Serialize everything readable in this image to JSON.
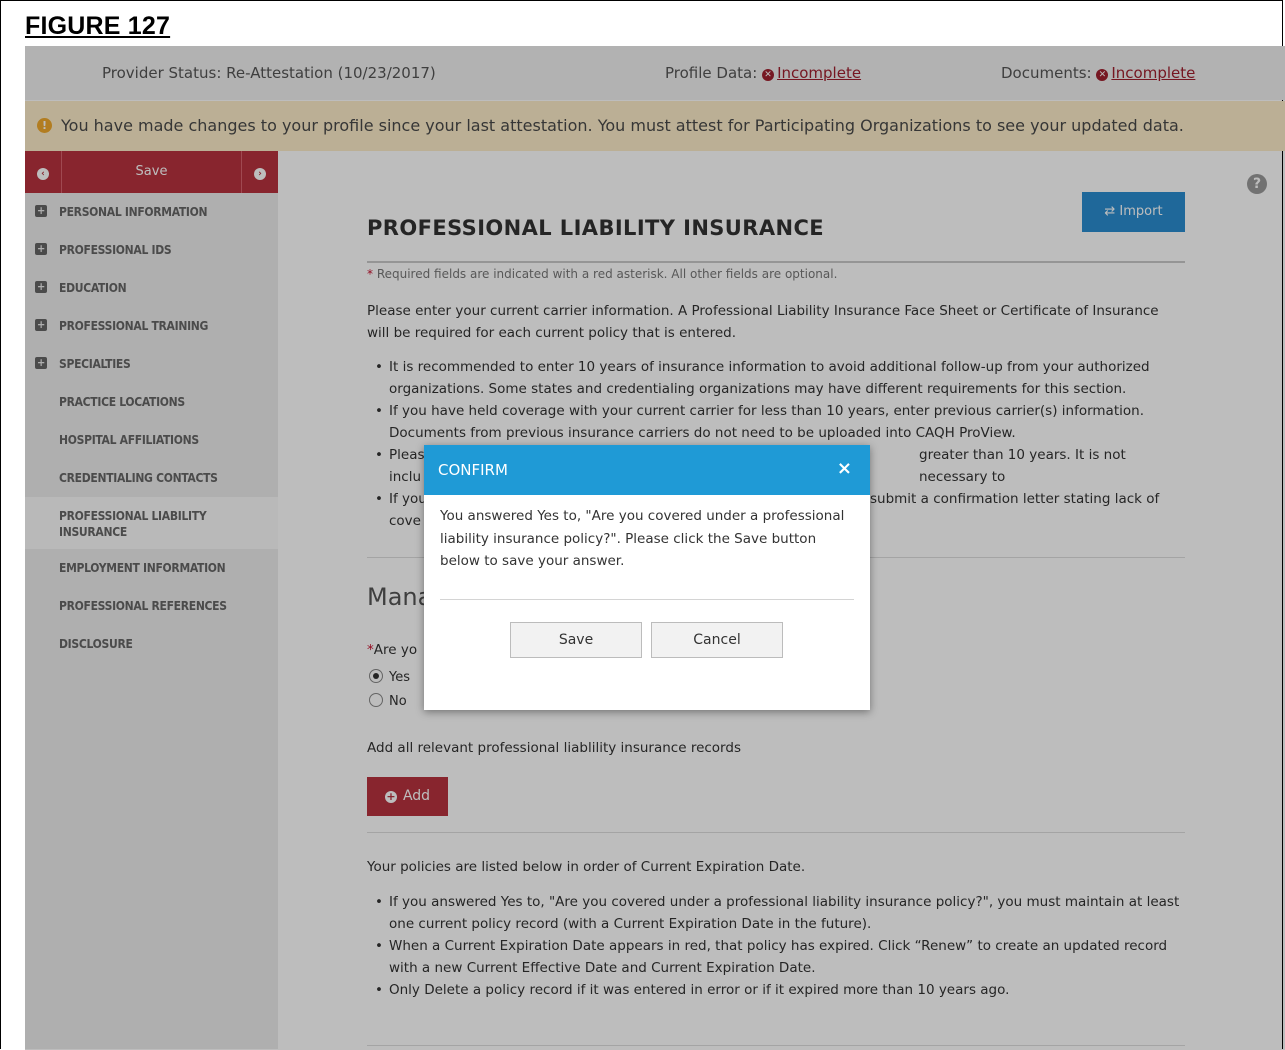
{
  "figure_label": "FIGURE 127",
  "status": {
    "provider_label": "Provider Status:",
    "provider_value": "Re-Attestation (10/23/2017)",
    "profile_label": "Profile Data:",
    "profile_value": "Incomplete",
    "documents_label": "Documents:",
    "documents_value": "Incomplete"
  },
  "alert": {
    "icon": "!",
    "text": "You have made changes to your profile since your last attestation. You must attest for Participating Organizations to see your updated data."
  },
  "sidebar": {
    "save_label": "Save",
    "items": [
      {
        "label": "PERSONAL INFORMATION",
        "expandable": true
      },
      {
        "label": "PROFESSIONAL IDS",
        "expandable": true
      },
      {
        "label": "EDUCATION",
        "expandable": true
      },
      {
        "label": "PROFESSIONAL TRAINING",
        "expandable": true
      },
      {
        "label": "SPECIALTIES",
        "expandable": true
      },
      {
        "label": "PRACTICE LOCATIONS",
        "expandable": false
      },
      {
        "label": "HOSPITAL AFFILIATIONS",
        "expandable": false
      },
      {
        "label": "CREDENTIALING CONTACTS",
        "expandable": false
      },
      {
        "label": "PROFESSIONAL LIABILITY INSURANCE",
        "expandable": false,
        "active": true
      },
      {
        "label": "EMPLOYMENT INFORMATION",
        "expandable": false
      },
      {
        "label": "PROFESSIONAL REFERENCES",
        "expandable": false
      },
      {
        "label": "DISCLOSURE",
        "expandable": false
      }
    ]
  },
  "main": {
    "import_label": "⇄ Import",
    "title": "PROFESSIONAL LIABILITY INSURANCE",
    "required_note_star": "*",
    "required_note": " Required fields are indicated with a red asterisk. All other fields are optional.",
    "intro": "Please enter your current carrier information. A Professional Liability Insurance Face Sheet or Certificate of Insurance will be required for each current policy that is entered.",
    "bullets_1": [
      "It is recommended to enter 10 years of insurance information to avoid additional follow-up from your authorized organizations. Some states and credentialing organizations may have different requirements for this section.",
      "If you have held coverage with your current carrier for less than 10 years, enter previous carrier(s) information. Documents from previous insurance carriers do not need to be uploaded into CAQH ProView.",
      "Pleas",
      "If you"
    ],
    "bullet3_tail": "greater than 10 years. It is not necessary to",
    "bullet3_line2": "inclu",
    "bullet4_tail": "submit a confirmation letter stating lack of",
    "bullet4_line2": "cove",
    "section2_title": "Mana",
    "question_star": "*",
    "question": "Are yo",
    "radio_yes": "Yes",
    "radio_no": "No",
    "radio_selected": "Yes",
    "add_note": "Add all relevant professional liablility insurance records",
    "add_label": "Add",
    "policies_note": "Your policies are listed below in order of Current Expiration Date.",
    "bullets_2": [
      "If you answered Yes to, \"Are you covered under a professional liability insurance policy?\", you must maintain at least one current policy record (with a Current Expiration Date in the future).",
      "When a Current Expiration Date appears in red, that policy has expired. Click “Renew” to create an updated record with a new Current Effective Date and Current Expiration Date.",
      "Only Delete a policy record if it was entered in error or if it expired more than 10 years ago."
    ]
  },
  "modal": {
    "title": "CONFIRM",
    "close": "×",
    "body": "You answered Yes to, \"Are you covered under a professional liability insurance policy?\". Please click the Save button below to save your answer.",
    "save_label": "Save",
    "cancel_label": "Cancel"
  },
  "colors": {
    "accent_red": "#b8333f",
    "modal_header": "#1f9ad6",
    "alert_bg": "#fcedc9",
    "import_blue": "#2a8dd0"
  }
}
